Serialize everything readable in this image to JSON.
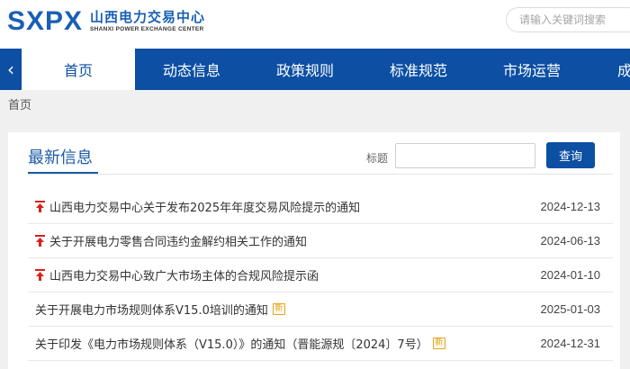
{
  "header": {
    "logo_mark": "SXPX",
    "logo_cn": "山西电力交易中心",
    "logo_en": "SHANXI POWER EXCHANGE CENTER",
    "search_placeholder": "请输入关键词搜索"
  },
  "nav": {
    "prev_arrow": "‹",
    "items": [
      {
        "label": "首页",
        "active": true
      },
      {
        "label": "动态信息"
      },
      {
        "label": "政策规则"
      },
      {
        "label": "标准规范"
      },
      {
        "label": "市场运营"
      },
      {
        "label": "成"
      }
    ]
  },
  "breadcrumb": "首页",
  "panel": {
    "title": "最新信息",
    "filter_label": "标题",
    "filter_value": "",
    "query_button": "查询",
    "items": [
      {
        "title": "山西电力交易中心关于发布2025年年度交易风险提示的通知",
        "date": "2024-12-13",
        "pinned": true,
        "new": false
      },
      {
        "title": "关于开展电力零售合同违约金解约相关工作的通知",
        "date": "2024-06-13",
        "pinned": true,
        "new": false
      },
      {
        "title": "山西电力交易中心致广大市场主体的合规风险提示函",
        "date": "2024-01-10",
        "pinned": true,
        "new": false
      },
      {
        "title": "关于开展电力市场规则体系V15.0培训的通知",
        "date": "2025-01-03",
        "pinned": false,
        "new": true
      },
      {
        "title": "关于印发《电力市场规则体系（V15.0）》的通知（晋能源规〔2024〕7号）",
        "date": "2024-12-31",
        "pinned": false,
        "new": true
      }
    ],
    "new_badge": "新"
  },
  "colors": {
    "brand": "#0c4fa3",
    "pin": "#d9201c",
    "badge": "#e2a623"
  },
  "icons": {
    "pin": "pin-top-icon",
    "nav_prev": "chevron-left-icon"
  }
}
